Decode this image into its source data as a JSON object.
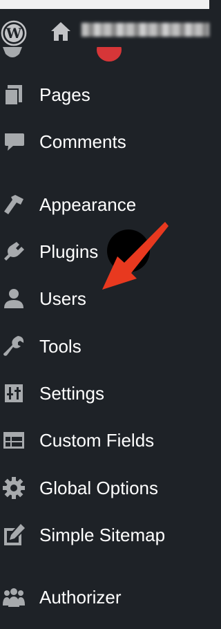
{
  "admin_bar": {
    "logo_icon": "wordpress-logo-icon",
    "home_icon": "home-icon"
  },
  "menu": {
    "items": [
      {
        "label": "Pages",
        "icon": "pages-icon"
      },
      {
        "label": "Comments",
        "icon": "comments-icon"
      },
      {
        "label": "Appearance",
        "icon": "appearance-icon"
      },
      {
        "label": "Plugins",
        "icon": "plugins-icon"
      },
      {
        "label": "Users",
        "icon": "users-icon"
      },
      {
        "label": "Tools",
        "icon": "tools-icon"
      },
      {
        "label": "Settings",
        "icon": "settings-icon"
      },
      {
        "label": "Custom Fields",
        "icon": "custom-fields-icon"
      },
      {
        "label": "Global Options",
        "icon": "global-options-icon"
      },
      {
        "label": "Simple Sitemap",
        "icon": "simple-sitemap-icon"
      },
      {
        "label": "Authorizer",
        "icon": "authorizer-icon"
      }
    ]
  },
  "annotation": {
    "color": "#e8391f"
  }
}
